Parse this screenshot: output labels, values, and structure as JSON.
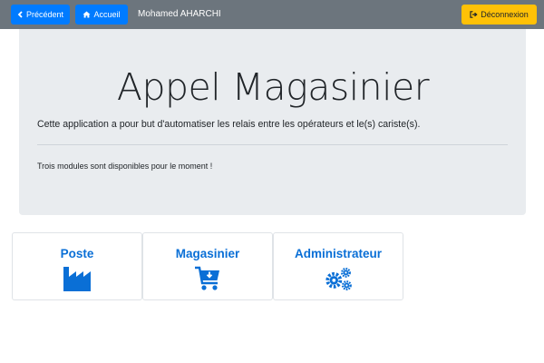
{
  "navbar": {
    "back_label": "Précédent",
    "back_icon": "chevron-left-icon",
    "home_label": "Accueil",
    "home_icon": "home-icon",
    "user_name": "Mohamed AHARCHI",
    "logout_label": "Déconnexion",
    "logout_icon": "sign-out-icon"
  },
  "jumbotron": {
    "title": "Appel Magasinier",
    "lead": "Cette application a pour but d'automatiser les relais entre les opérateurs et le(s) cariste(s).",
    "info": "Trois modules sont disponibles pour le moment !"
  },
  "modules": [
    {
      "label": "Poste",
      "icon": "factory-icon"
    },
    {
      "label": "Magasinier",
      "icon": "cart-download-icon"
    },
    {
      "label": "Administrateur",
      "icon": "gears-icon"
    }
  ],
  "colors": {
    "navbar_bg": "#6c757d",
    "primary": "#007bff",
    "warning": "#ffc107",
    "jumbotron_bg": "#e9ecef",
    "module_title": "#0a6fd6"
  }
}
